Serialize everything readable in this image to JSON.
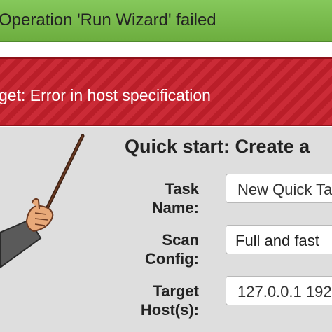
{
  "notifications": {
    "success_text": "Operation 'Run Wizard' failed",
    "error_text": "get: Error in host specification"
  },
  "quick_start": {
    "heading": "Quick start: Create a",
    "task_name_label": "Task Name:",
    "task_name_value": "New Quick Ta",
    "scan_config_label": "Scan Config:",
    "scan_config_value": "Full and fast",
    "target_hosts_label": "Target Host(s):",
    "target_hosts_value": "127.0.0.1 192"
  },
  "colors": {
    "success_green": "#7bbf4e",
    "error_red": "#c8202c",
    "panel_gray": "#dedede"
  }
}
